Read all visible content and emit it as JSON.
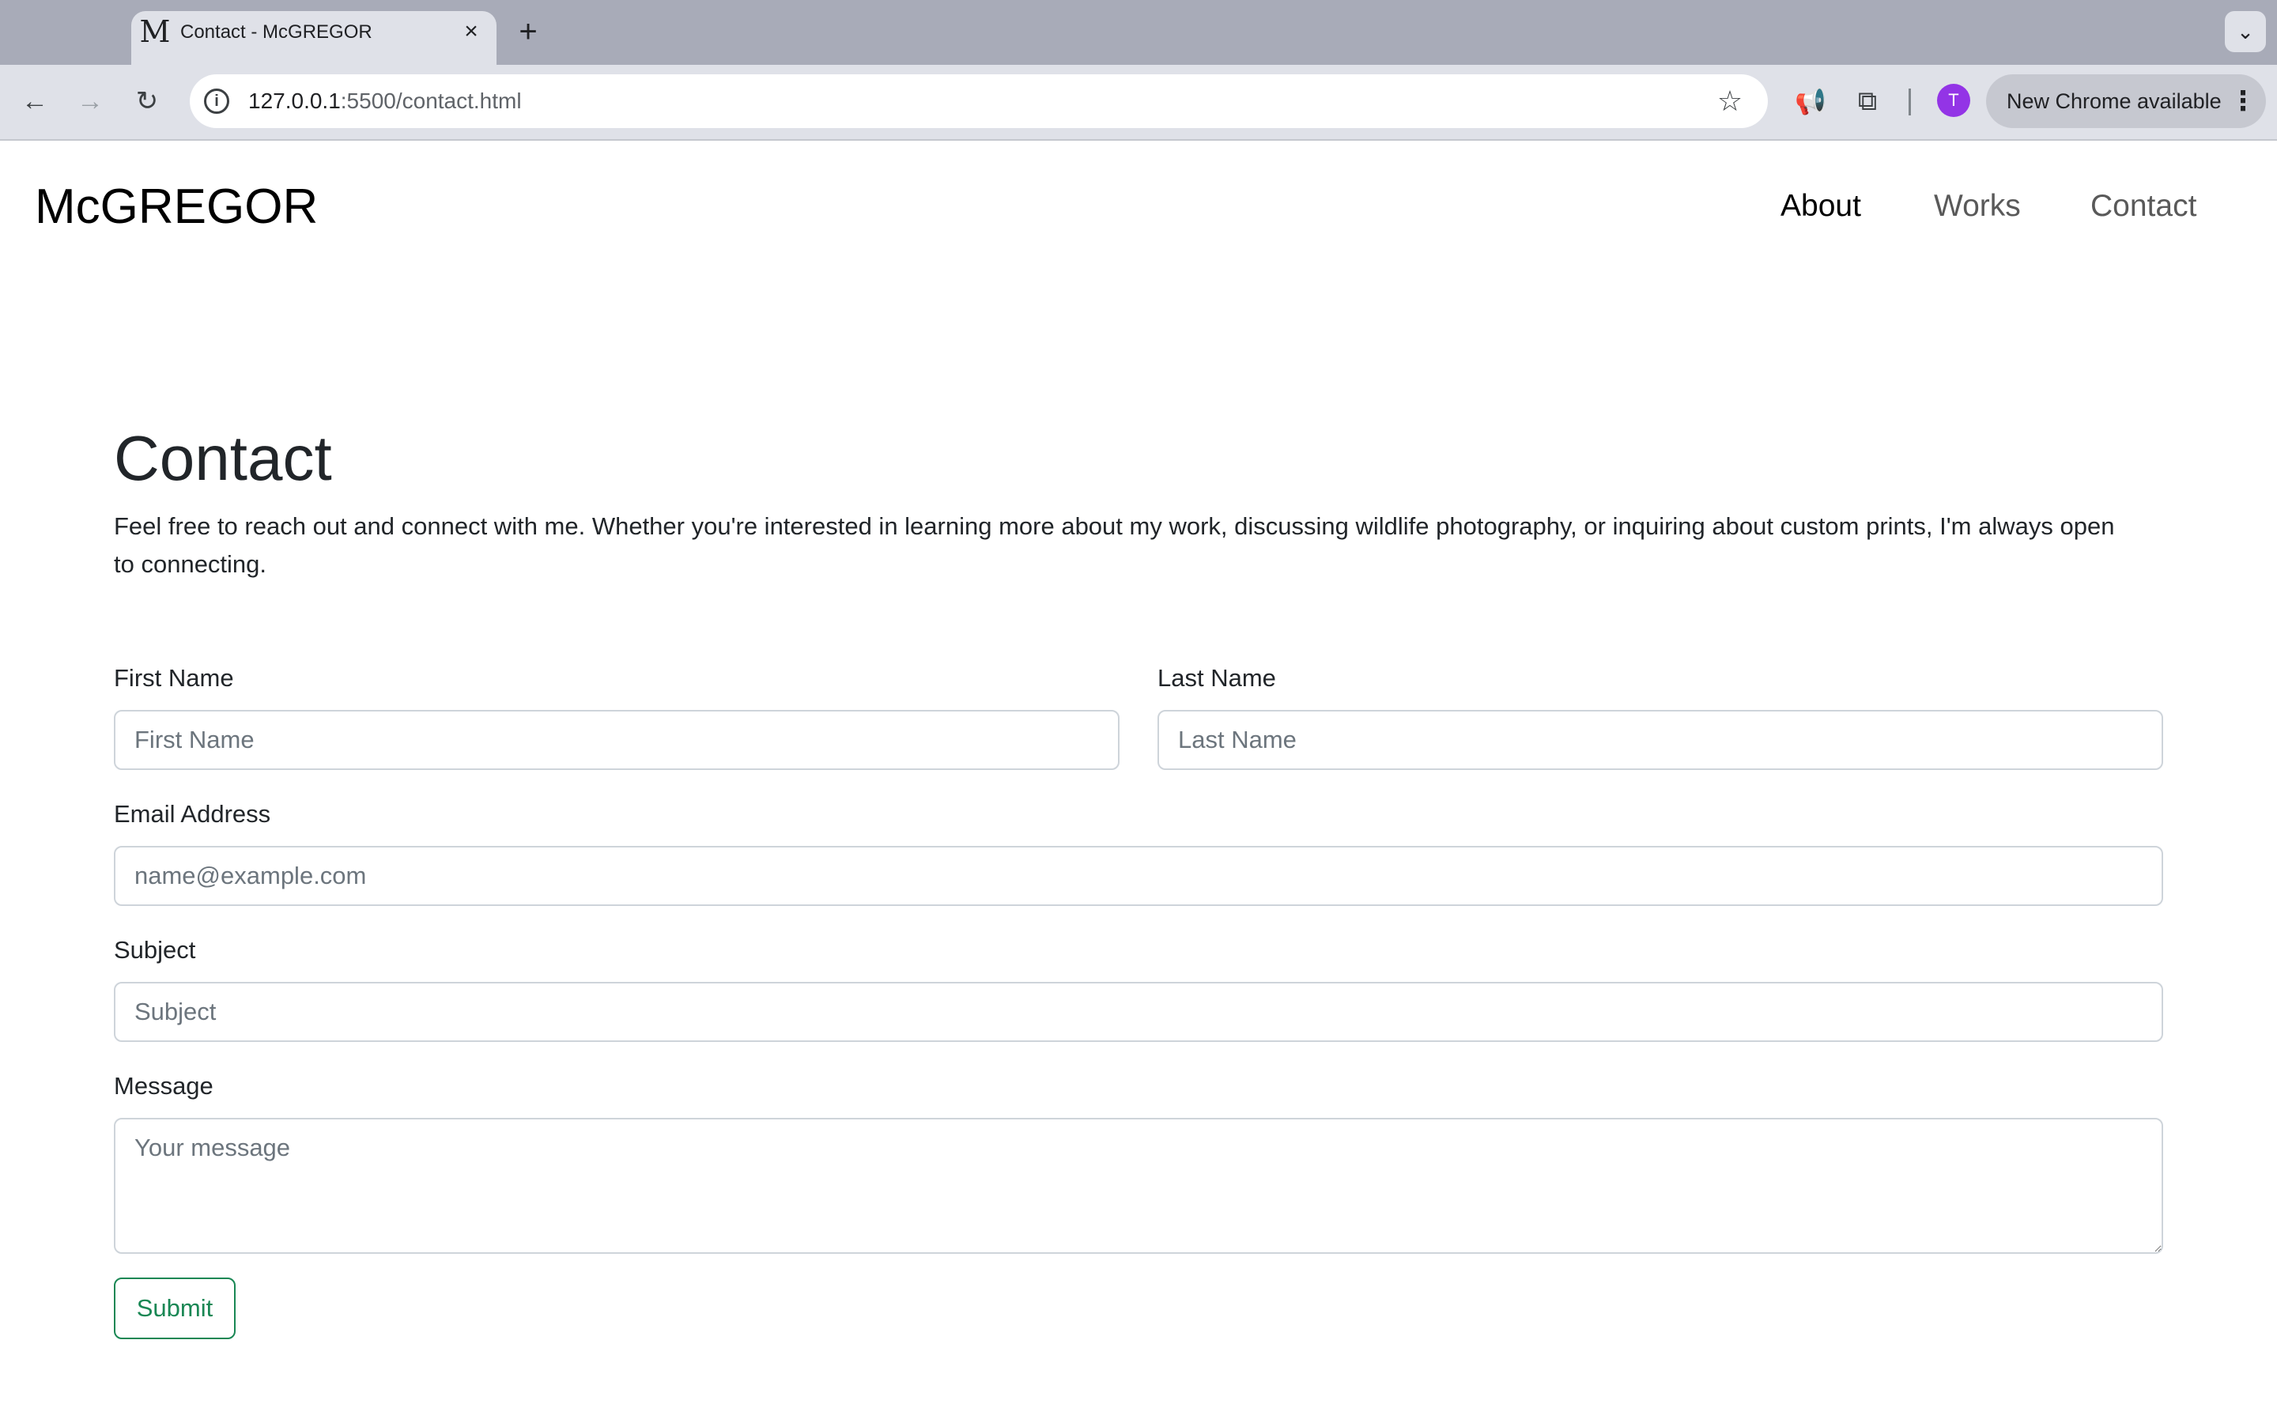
{
  "browser": {
    "tab": {
      "favicon": "M",
      "title": "Contact - McGREGOR",
      "close_icon": "close-icon"
    },
    "new_tab_label": "+",
    "address": {
      "host": "127.0.0.1",
      "rest": ":5500/contact.html"
    },
    "avatar_letter": "T",
    "update_label": "New Chrome available",
    "accent_color": "#9334e6"
  },
  "site": {
    "brand": "McGREGOR",
    "nav": [
      {
        "label": "About",
        "active": true
      },
      {
        "label": "Works",
        "active": false
      },
      {
        "label": "Contact",
        "active": false
      }
    ]
  },
  "main": {
    "title": "Contact",
    "intro": "Feel free to reach out and connect with me. Whether you're interested in learning more about my work, discussing wildlife photography, or inquiring about custom prints, I'm always open to connecting."
  },
  "form": {
    "first_name": {
      "label": "First Name",
      "placeholder": "First Name",
      "value": ""
    },
    "last_name": {
      "label": "Last Name",
      "placeholder": "Last Name",
      "value": ""
    },
    "email": {
      "label": "Email Address",
      "placeholder": "name@example.com",
      "value": ""
    },
    "subject": {
      "label": "Subject",
      "placeholder": "Subject",
      "value": ""
    },
    "message": {
      "label": "Message",
      "placeholder": "Your message",
      "value": ""
    },
    "submit_label": "Submit",
    "submit_color": "#198754"
  }
}
